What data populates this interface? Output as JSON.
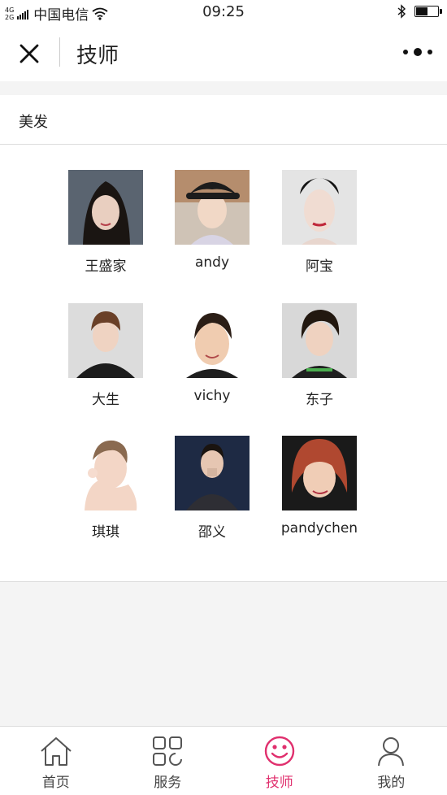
{
  "status_bar": {
    "network": "4G",
    "network2": "2G",
    "carrier": "中国电信",
    "time": "09:25"
  },
  "nav": {
    "title": "技师"
  },
  "section": {
    "title": "美发"
  },
  "technicians": [
    {
      "name": "王盛家"
    },
    {
      "name": "andy"
    },
    {
      "name": "阿宝"
    },
    {
      "name": "大生"
    },
    {
      "name": "vichy"
    },
    {
      "name": "东子"
    },
    {
      "name": "琪琪"
    },
    {
      "name": "邵义"
    },
    {
      "name": "pandychen"
    }
  ],
  "tabbar": {
    "items": [
      {
        "label": "首页",
        "icon": "home-icon"
      },
      {
        "label": "服务",
        "icon": "grid-icon"
      },
      {
        "label": "技师",
        "icon": "smile-icon"
      },
      {
        "label": "我的",
        "icon": "user-icon"
      }
    ],
    "active_index": 2,
    "active_color": "#e0306e"
  },
  "battery_level": 0.6
}
